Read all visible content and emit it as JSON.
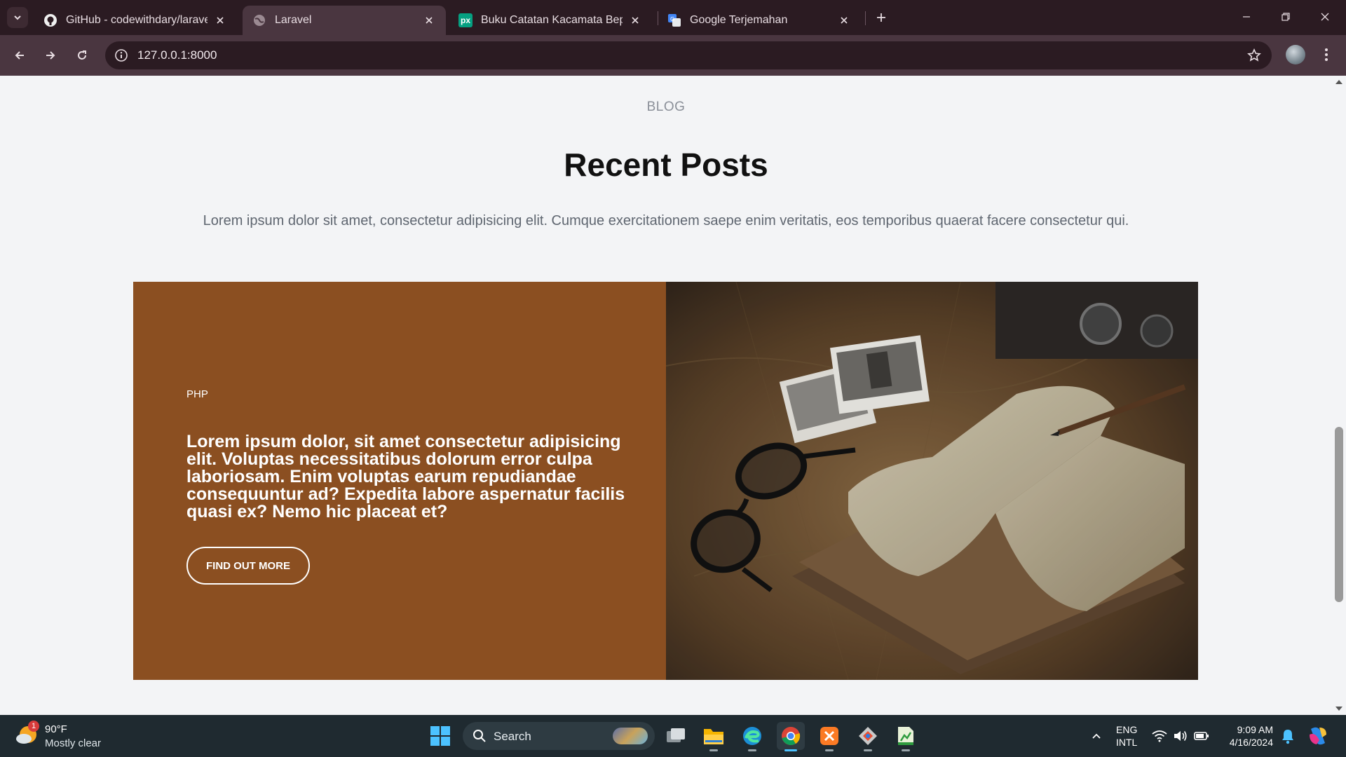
{
  "browser": {
    "tabs": [
      {
        "title": "GitHub - codewithdary/laravel-",
        "favicon": "github-icon",
        "active": false
      },
      {
        "title": "Laravel",
        "favicon": "globe-icon",
        "active": true
      },
      {
        "title": "Buku Catatan Kacamata Beperg",
        "favicon": "pexels-icon",
        "active": false
      },
      {
        "title": "Google Terjemahan",
        "favicon": "google-translate-icon",
        "active": false
      }
    ],
    "url": "127.0.0.1:8000",
    "pexels_mark": "px"
  },
  "page": {
    "eyebrow": "BLOG",
    "heading": "Recent Posts",
    "lede": "Lorem ipsum dolor sit amet, consectetur adipisicing elit. Cumque exercitationem saepe enim veritatis, eos temporibus quaerat facere consectetur qui.",
    "card": {
      "tag": "PHP",
      "title": "Lorem ipsum dolor, sit amet consectetur adipisicing elit. Voluptas necessitatibus dolorum error culpa laboriosam. Enim voluptas earum repudiandae consequuntur ad? Expedita labore aspernatur facilis quasi ex? Nemo hic placeat et?",
      "button": "FIND OUT MORE",
      "panel_color": "#8b4f21"
    }
  },
  "taskbar": {
    "weather": {
      "temp": "90°F",
      "condition": "Mostly clear",
      "badge": "1"
    },
    "search_label": "Search",
    "lang_line1": "ENG",
    "lang_line2": "INTL",
    "time": "9:09 AM",
    "date": "4/16/2024"
  },
  "colors": {
    "chrome_dark": "#2b1b22",
    "chrome_toolbar": "#4a3640",
    "page_bg": "#f3f4f6",
    "card_brown": "#8b4f21",
    "taskbar": "#1f2a30",
    "accent": "#4cc2ff"
  }
}
